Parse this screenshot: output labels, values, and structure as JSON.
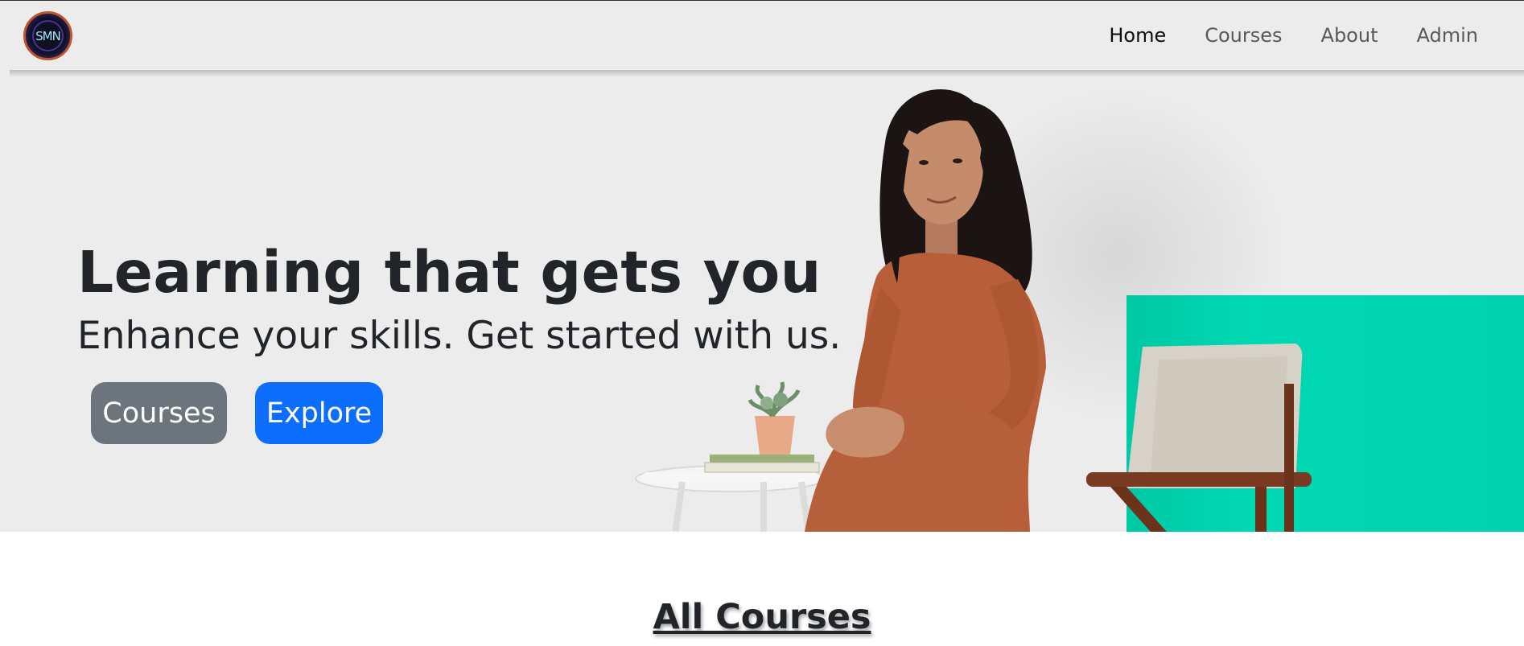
{
  "brand": {
    "logo_text": "SMN",
    "logo_colors": {
      "ring": "#c0552a",
      "bg": "#0f1020",
      "text": "#9fe6ff"
    }
  },
  "nav": {
    "items": [
      {
        "label": "Home",
        "active": true
      },
      {
        "label": "Courses",
        "active": false
      },
      {
        "label": "About",
        "active": false
      },
      {
        "label": "Admin",
        "active": false
      }
    ]
  },
  "hero": {
    "title": "Learning that gets you",
    "subtitle": "Enhance your skills. Get started with us.",
    "buttons": {
      "courses_label": "Courses",
      "explore_label": "Explore"
    },
    "colors": {
      "background": "#ececec",
      "accent": "#00d2ae",
      "courses_btn": "#6c757d",
      "explore_btn": "#0d6efd"
    }
  },
  "section": {
    "title": "All Courses"
  }
}
